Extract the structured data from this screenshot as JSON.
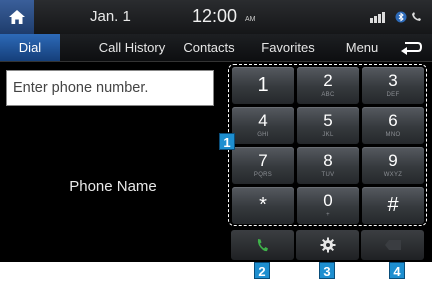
{
  "status": {
    "date": "Jan.  1",
    "time": "12:00",
    "ampm": "AM",
    "icons": [
      "home-icon",
      "signal-icon",
      "bluetooth-icon"
    ]
  },
  "tabs": [
    {
      "label": "Dial",
      "active": true
    },
    {
      "label": "Call History",
      "active": false
    },
    {
      "label": "Contacts",
      "active": false
    },
    {
      "label": "Favorites",
      "active": false
    },
    {
      "label": "Menu",
      "active": false
    }
  ],
  "dial": {
    "placeholder": "Enter phone number.",
    "phone_name": "Phone Name"
  },
  "keypad": [
    {
      "digit": "1",
      "sub": ""
    },
    {
      "digit": "2",
      "sub": "ABC"
    },
    {
      "digit": "3",
      "sub": "DEF"
    },
    {
      "digit": "4",
      "sub": "GHI"
    },
    {
      "digit": "5",
      "sub": "JKL"
    },
    {
      "digit": "6",
      "sub": "MNO"
    },
    {
      "digit": "7",
      "sub": "PQRS"
    },
    {
      "digit": "8",
      "sub": "TUV"
    },
    {
      "digit": "9",
      "sub": "WXYZ"
    },
    {
      "digit": "*",
      "sub": ""
    },
    {
      "digit": "0",
      "sub": "+"
    },
    {
      "digit": "#",
      "sub": ""
    }
  ],
  "bottom": {
    "icons": [
      "call-icon",
      "settings-icon",
      "delete-icon"
    ],
    "call_color": "#3fb24a"
  },
  "callouts": [
    "1",
    "2",
    "3",
    "4"
  ],
  "colors": {
    "accent": "#1e8fd0",
    "tab_active": "#2d6ab8"
  }
}
